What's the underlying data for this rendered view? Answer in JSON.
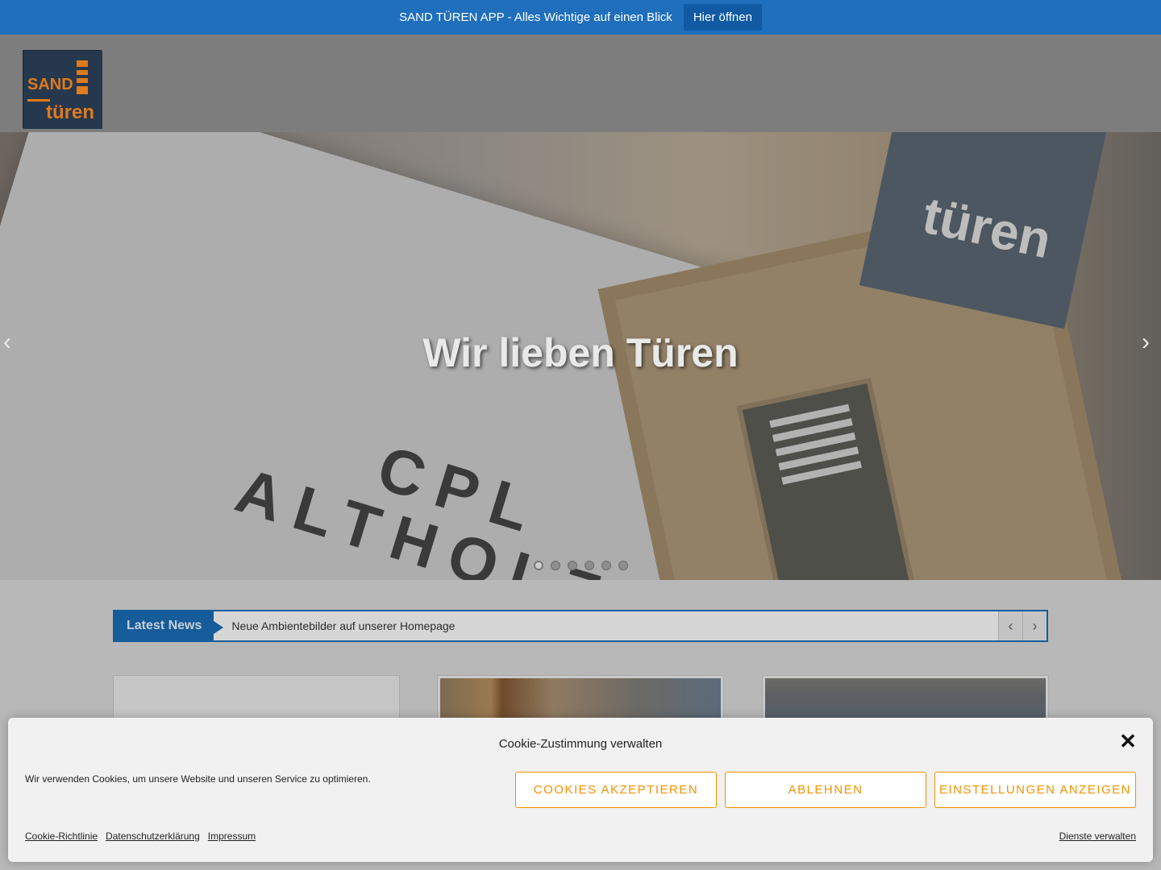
{
  "app_banner": {
    "text": "SAND TÜREN APP - Alles Wichtige auf einen Blick",
    "button_label": "Hier öffnen"
  },
  "header": {
    "logo_text_top": "SAND",
    "logo_text_bottom": "türen"
  },
  "hero": {
    "title": "Wir lieben Türen",
    "image_text_line1": "CPL",
    "image_text_line2": "ALTHOLZ",
    "sign_text": "türen",
    "slide_count": 6,
    "active_slide": 1
  },
  "news": {
    "label": "Latest News",
    "headline": "Neue Ambientebilder auf unserer Homepage"
  },
  "cookie": {
    "title": "Cookie-Zustimmung verwalten",
    "message": "Wir verwenden Cookies, um unsere Website und unseren Service zu optimieren.",
    "buttons": [
      "Cookies akzeptieren",
      "Ablehnen",
      "Einstellungen anzeigen"
    ],
    "links": [
      "Cookie-Richtlinie",
      "Datenschutzerklärung",
      "Impressum"
    ],
    "manage_label": "Dienste verwalten"
  },
  "colors": {
    "banner": "#1f6fbd",
    "news_accent": "#165c9a",
    "cookie_accent": "#f39200"
  }
}
